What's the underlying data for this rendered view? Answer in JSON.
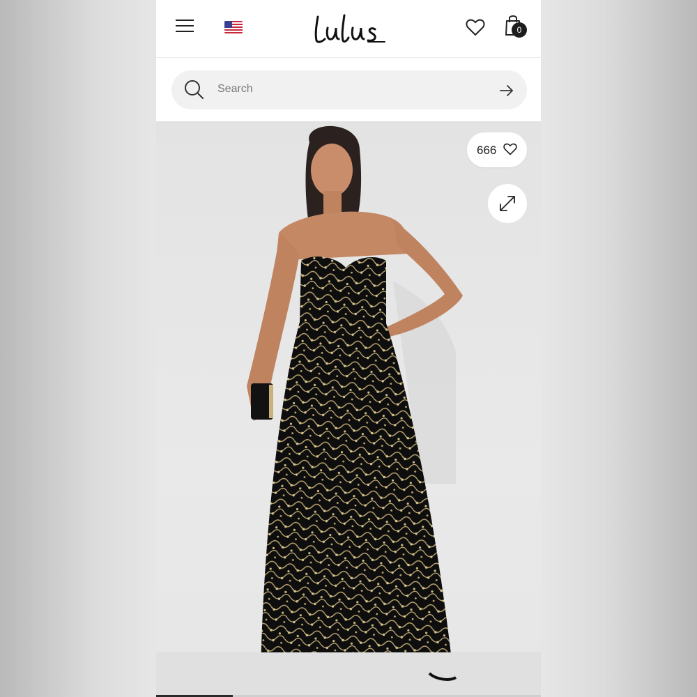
{
  "header": {
    "brand": "Lulus",
    "cart_count": "0",
    "icons": [
      "menu-icon",
      "us-flag-icon",
      "heart-icon",
      "shopping-bag-icon"
    ]
  },
  "search": {
    "placeholder": "Search",
    "icons": [
      "search-icon",
      "arrow-right-icon"
    ]
  },
  "product_image": {
    "like_count": "666",
    "icons": [
      "heart-icon",
      "expand-icon"
    ]
  },
  "gallery": {
    "progress": 0.2
  },
  "colors": {
    "text": "#222222",
    "search_bg": "#f1f1f1",
    "badge_bg": "#1d1d1d",
    "dress": "#0e0e0e",
    "sequin": "#c9b37a"
  }
}
